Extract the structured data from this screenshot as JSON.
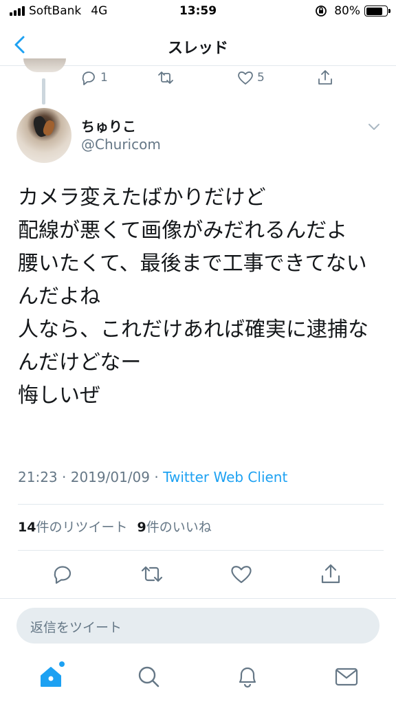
{
  "status_bar": {
    "carrier": "SoftBank",
    "network": "4G",
    "time": "13:59",
    "battery_percent": "80%",
    "battery_level": 0.8
  },
  "nav": {
    "title": "スレッド"
  },
  "parent_tweet": {
    "reply_count": "1",
    "like_count": "5"
  },
  "tweet": {
    "display_name": "ちゅりこ",
    "handle": "@Churicom",
    "text": "カメラ変えたばかりだけど\n配線が悪くて画像がみだれるんだよ\n腰いたくて、最後まで工事できてないんだよね\n人なら、これだけあれば確実に逮捕なんだけどなー\n悔しいぜ",
    "time": "21:23",
    "date": "2019/01/09",
    "client": "Twitter Web Client",
    "separator": " · ",
    "retweet_count": "14",
    "retweet_label": "件のリツイート",
    "like_count": "9",
    "like_label": "件のいいね"
  },
  "reply": {
    "placeholder": "返信をツイート"
  },
  "tabbar": {
    "items": [
      "home-icon",
      "search-icon",
      "notifications-icon",
      "messages-icon"
    ]
  },
  "colors": {
    "accent": "#1da1f2",
    "text": "#14171a",
    "secondary": "#657786",
    "border": "#e1e8ed"
  }
}
